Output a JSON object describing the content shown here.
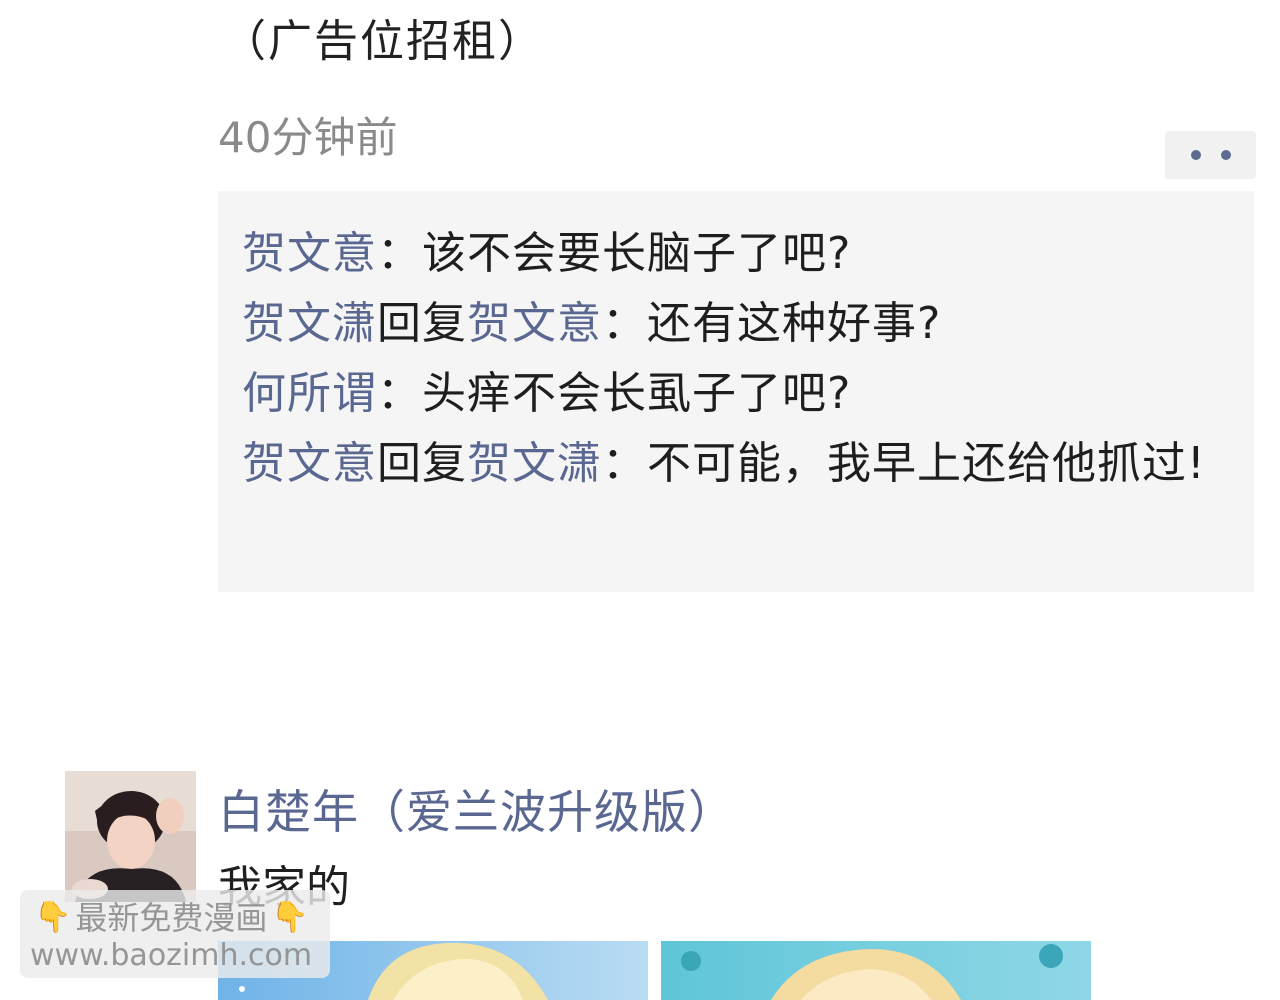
{
  "previous_post": {
    "tail_text": "（广告位招租）",
    "timestamp": "40分钟前"
  },
  "more_button_icon": "more-dots-icon",
  "comments": [
    {
      "author": "贺文意",
      "reply_to": "",
      "text": "：该不会要长脑子了吧?"
    },
    {
      "author": "贺文潇",
      "reply_label": "回复",
      "reply_to": "贺文意",
      "text": "：还有这种好事?"
    },
    {
      "author": "何所谓",
      "reply_to": "",
      "text": "：头痒不会长虱子了吧?"
    },
    {
      "author": "贺文意",
      "reply_label": "回复",
      "reply_to": "贺文潇",
      "text": "：不可能，我早上还给他抓过!"
    }
  ],
  "next_post": {
    "author": "白楚年（爱兰波升级版）",
    "text": "我家的"
  },
  "watermark": {
    "line1": "最新免费漫画",
    "line2": "www.baozimh.com",
    "hand_icon": "pointing-down-hand-icon"
  },
  "colors": {
    "nickname": "#5a6790",
    "comment_bg": "#f5f5f5",
    "timestamp": "#8a8a8a"
  }
}
